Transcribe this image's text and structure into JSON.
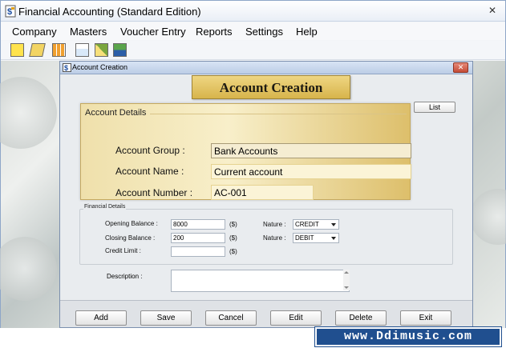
{
  "window": {
    "title": "Financial Accounting (Standard Edition)",
    "close_glyph": "✕"
  },
  "menu": {
    "items": [
      "Company",
      "Masters",
      "Voucher Entry",
      "Reports",
      "Settings",
      "Help"
    ]
  },
  "toolbar": {
    "icons": [
      "new-file-icon",
      "open-folder-icon",
      "calculator-icon",
      "voucher-icon",
      "edit-icon",
      "export-icon"
    ]
  },
  "child_window": {
    "title": "Account Creation",
    "close_glyph": "✕"
  },
  "form": {
    "heading": "Account Creation",
    "list_button": "List",
    "account_details": {
      "legend": "Account Details",
      "group_label": "Account Group :",
      "group_value": "Bank Accounts",
      "name_label": "Account Name :",
      "name_value": "Current account",
      "number_label": "Account Number :",
      "number_value": "AC-001"
    },
    "financial_details": {
      "legend": "Financial Details",
      "opening_label": "Opening Balance :",
      "opening_value": "8000",
      "opening_unit": "($)",
      "closing_label": "Closing Balance :",
      "closing_value": "200",
      "closing_unit": "($)",
      "credit_label": "Credit Limit :",
      "credit_value": "",
      "credit_unit": "($)",
      "nature1_label": "Nature :",
      "nature1_value": "CREDIT",
      "nature2_label": "Nature :",
      "nature2_value": "DEBIT"
    },
    "description_label": "Description :",
    "description_value": ""
  },
  "buttons": {
    "add": "Add",
    "save": "Save",
    "cancel": "Cancel",
    "edit": "Edit",
    "delete": "Delete",
    "exit": "Exit"
  },
  "watermark": "www.Ddimusic.com"
}
